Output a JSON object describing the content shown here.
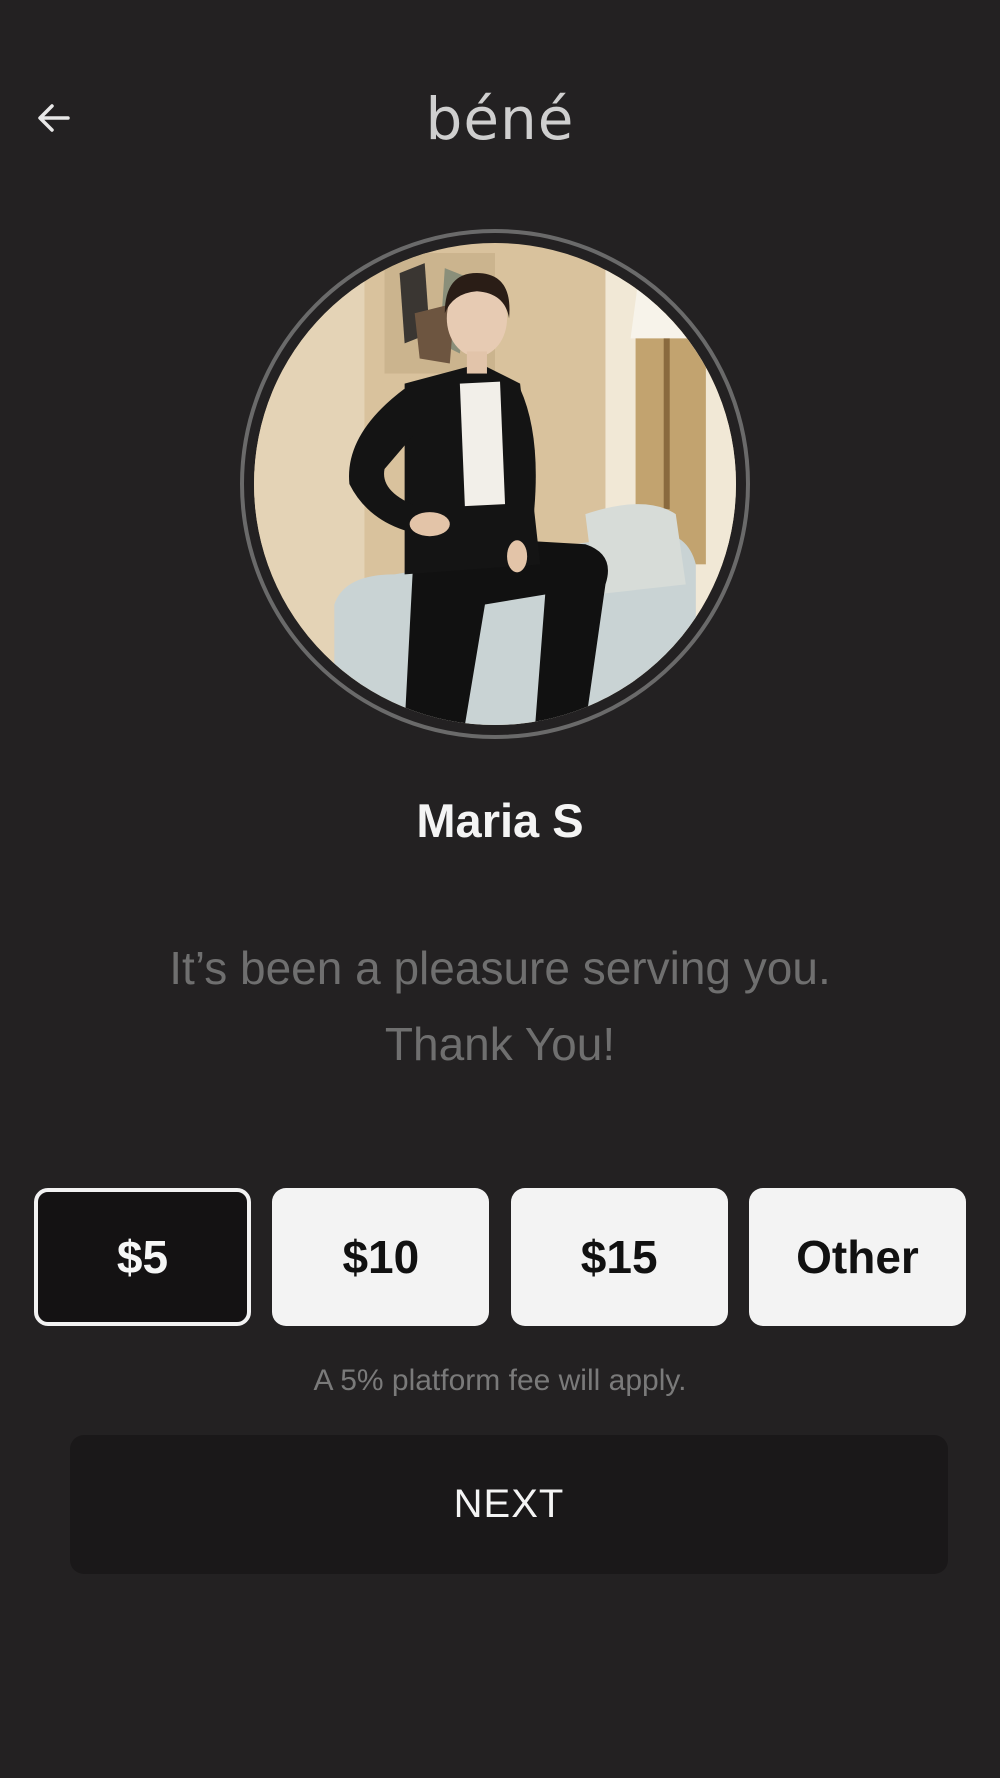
{
  "header": {
    "back_icon": "arrow-left-icon",
    "logo_text": "béné"
  },
  "profile": {
    "name": "Maria S",
    "photo": "profile-photo"
  },
  "message": {
    "line1": "It’s been a pleasure serving you.",
    "line2": "Thank You!"
  },
  "tip_options": [
    {
      "label": "$5",
      "selected": true
    },
    {
      "label": "$10",
      "selected": false
    },
    {
      "label": "$15",
      "selected": false
    },
    {
      "label": "Other",
      "selected": false
    }
  ],
  "fee_note": "A 5% platform fee will apply.",
  "next_label": "NEXT",
  "colors": {
    "background": "#232122",
    "selected_tip_bg": "#141213",
    "tip_bg": "#f3f3f3",
    "next_bg": "#1a1819",
    "muted_text": "#6f6f6f"
  }
}
